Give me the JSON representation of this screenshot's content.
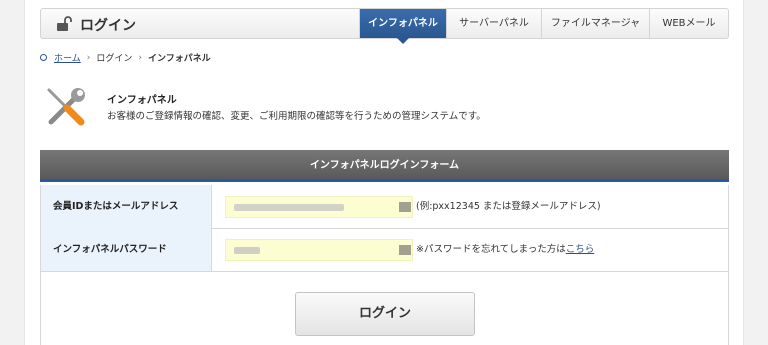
{
  "header": {
    "title": "ログイン",
    "tabs": [
      {
        "label": "インフォパネル",
        "active": true
      },
      {
        "label": "サーバーパネル",
        "active": false
      },
      {
        "label": "ファイルマネージャ",
        "active": false
      },
      {
        "label": "WEBメール",
        "active": false
      }
    ]
  },
  "breadcrumb": {
    "home": "ホーム",
    "login": "ログイン",
    "current": "インフォパネル"
  },
  "intro": {
    "title": "インフォパネル",
    "description": "お客様のご登録情報の確認、変更、ご利用期限の確認等を行うための管理システムです。",
    "icon": "tools-icon"
  },
  "form": {
    "heading": "インフォパネルログインフォーム",
    "id_label": "会員IDまたはメールアドレス",
    "id_hint": "(例:pxx12345 または登録メールアドレス)",
    "password_label": "インフォパネルパスワード",
    "password_hint": "※パスワードを忘れてしまった方は",
    "password_link": "こちら",
    "submit_label": "ログイン"
  },
  "colors": {
    "accent": "#2a578f",
    "label_bg": "#eaf2fb",
    "input_bg": "#fdfdd2",
    "form_head": "#666666"
  }
}
